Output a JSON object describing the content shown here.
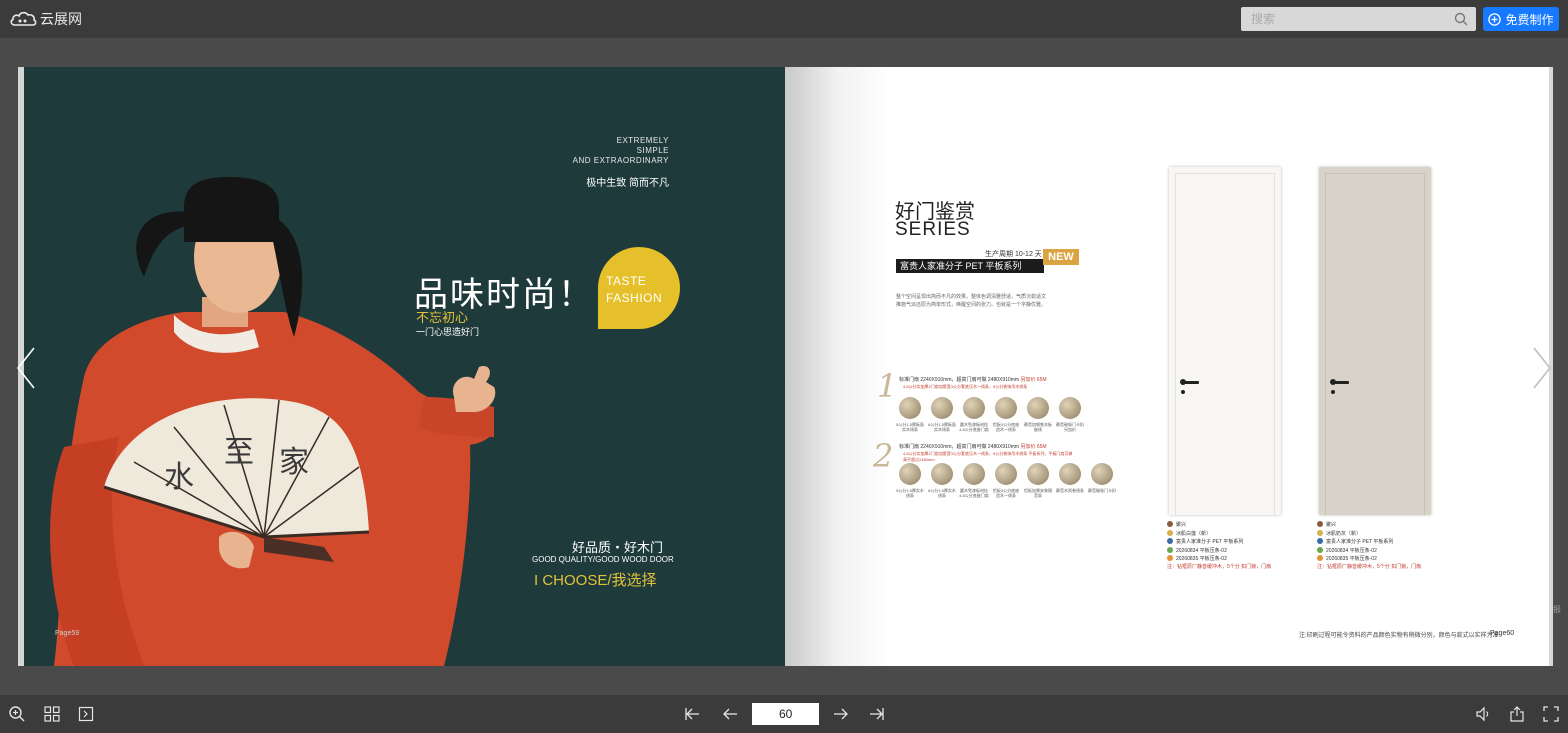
{
  "header": {
    "logo_text": "云展网",
    "search_placeholder": "搜索",
    "create_button": "免费制作"
  },
  "left_page": {
    "english_lines": [
      "EXTREMELY",
      "SIMPLE",
      "AND EXTRAORDINARY"
    ],
    "slogan": "极中生致 简而不凡",
    "headline": "品味时尚！",
    "sub_yellow": "不忘初心",
    "sub_white": "一门心思造好门",
    "bubble_line1": "TASTE",
    "bubble_line2": "FASHION",
    "quality_cn": "好品质・好木门",
    "quality_en": "GOOD QUALITY/GOOD WOOD DOOR",
    "choose": "I CHOOSE/我选择",
    "page_label": "Page59"
  },
  "right_page": {
    "series_title": "好门鉴赏",
    "series_en": "SERIES",
    "cycle": "生产周期 10-12 天",
    "bar_title": "富贵人家准分子 PET 平板系列",
    "new_badge": "NEW",
    "description": "整个空间呈现出简而不凡的效果。整体色调清雅舒适，气质沉稳适文推施气派还原为简单形式，唤醒空间的张力。也就是一个字静优雅。",
    "option1_num": "1",
    "option1_spec": "标准门扇 2240X910mm，超高门扇可做 2480X910mm",
    "option1_price": "另加价 65M",
    "option1_red": "4.8公分实加厚2门扇加套宽3公分套底压木一线条，5公分装饰吊木线条",
    "option1_chips": [
      "5公分1.5厚板面实木线条",
      "6公分1.5厚板面实木线条",
      "圆木免漆板材挂4.8公分底座门扇",
      "铝板3公分底座造木一线条",
      "静音加钢铁木板嵌线",
      "静音磁吸门卡扣另加价"
    ],
    "option2_num": "2",
    "option2_spec": "标准门扇 2240X910mm，超高门扇可做 2480X910mm",
    "option2_price": "另加价 65M",
    "option2_red": "4.8公分实加厚2门扇加套宽3公分套底压木一线条，5公分装饰吊木线条 平板系列，平板门扇可做高不超过2480mm",
    "option2_chips": [
      "5公分1.5厚实木线条",
      "6公分1.5厚实木线条",
      "圆木免漆板材挂4.8公分底座门扇",
      "铝板3公分底座造木一线条",
      "铝板加厚安装隔音条",
      "静音木质卷线条",
      "静音磁吸门卡扣"
    ],
    "door1_info": [
      "聚兴",
      "冰肌白莲（新）",
      "富贵人家准分子 PET 平板系列",
      "20260834 平板压条-02",
      "20260835 平板压条-02",
      "注：钻框原厂静音缓冲木，5个分 扣门锁，门扇"
    ],
    "door2_info": [
      "聚兴",
      "冰肌奶灰（新）",
      "富贵人家准分子 PET 平板系列",
      "20260834 平板压条-02",
      "20260835 平板压条-02",
      "注：钻框原厂静音缓冲木，5个分 扣门锁，门扇"
    ],
    "note": "注:印刷过程可能令资料的产品颜色实物有稍微分别，颜色与款式以实样为准",
    "page_label": "Page60"
  },
  "bottom": {
    "page_value": "60"
  },
  "side_text": "报",
  "colors": {
    "accent": "#1679ff",
    "left_page_bg": "#1f3a3a",
    "yellow": "#e2c23a"
  },
  "icons": [
    "cloud-logo-icon",
    "search-icon",
    "plus-circle-icon",
    "zoom-in-icon",
    "grid-icon",
    "thumbnails-icon",
    "first-page-icon",
    "prev-page-icon",
    "next-page-icon",
    "last-page-icon",
    "volume-icon",
    "share-icon",
    "fullscreen-icon"
  ]
}
